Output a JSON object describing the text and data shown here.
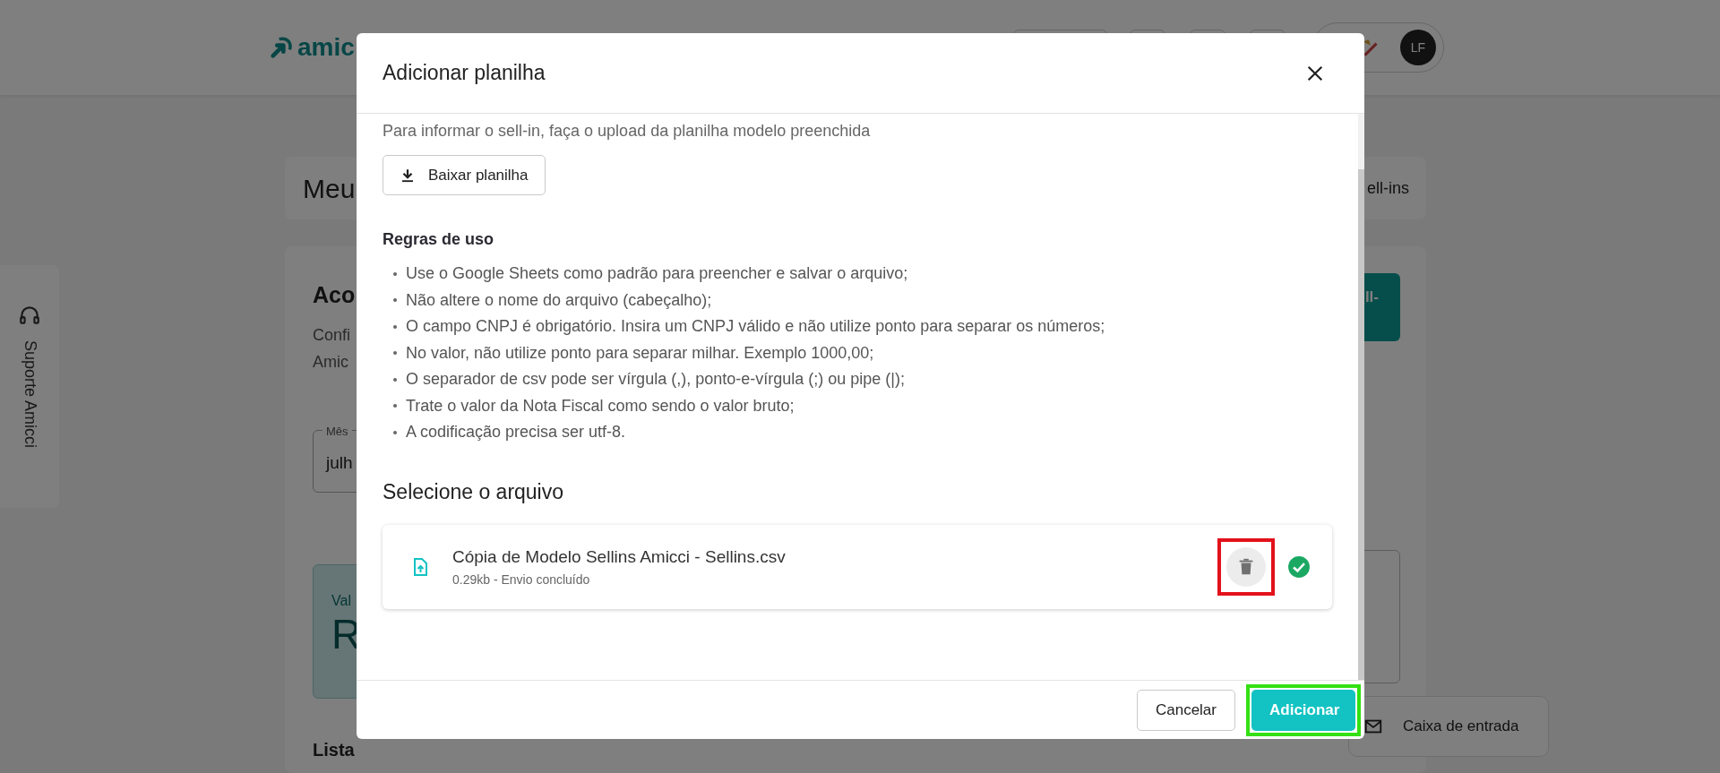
{
  "background": {
    "logo": "amic",
    "avatar": "LF",
    "page_title": "Meu",
    "page_action": "ell-ins",
    "section_title": "Aco",
    "section_text": [
      "Confi",
      "Amic"
    ],
    "month_field": {
      "label": "Mês",
      "value": "julh"
    },
    "primary_button": "ll-",
    "value_card": {
      "label": "Val",
      "value": "R"
    },
    "list_title": "Lista",
    "support_tab": "Suporte Amicci",
    "inbox_button": "Caixa de entrada"
  },
  "dialog": {
    "title": "Adicionar planilha",
    "intro": "Para informar o sell-in, faça o upload da planilha modelo preenchida",
    "download_button": "Baixar planilha",
    "rules_title": "Regras de uso",
    "rules": [
      "Use o Google Sheets como padrão para preencher e salvar o arquivo;",
      "Não altere o nome do arquivo (cabeçalho);",
      "O campo CNPJ é obrigatório. Insira um CNPJ válido e não utilize ponto para separar os números;",
      "No valor, não utilize ponto para separar milhar. Exemplo 1000,00;",
      "O separador de csv pode ser vírgula (,), ponto-e-vírgula (;) ou pipe (|);",
      "Trate o valor da Nota Fiscal como sendo o valor bruto;",
      "A codificação precisa ser utf-8."
    ],
    "file_section_title": "Selecione o arquivo",
    "files": [
      {
        "name": "Cópia de Modelo Sellins Amicci - Sellins.csv",
        "meta": "0.29kb - Envio concluído",
        "uploaded": true,
        "delete_highlighted": true
      }
    ],
    "buttons": [
      {
        "label": "Cancelar",
        "kind": "secondary"
      },
      {
        "label": "Adicionar",
        "kind": "primary",
        "highlighted": true
      }
    ]
  }
}
